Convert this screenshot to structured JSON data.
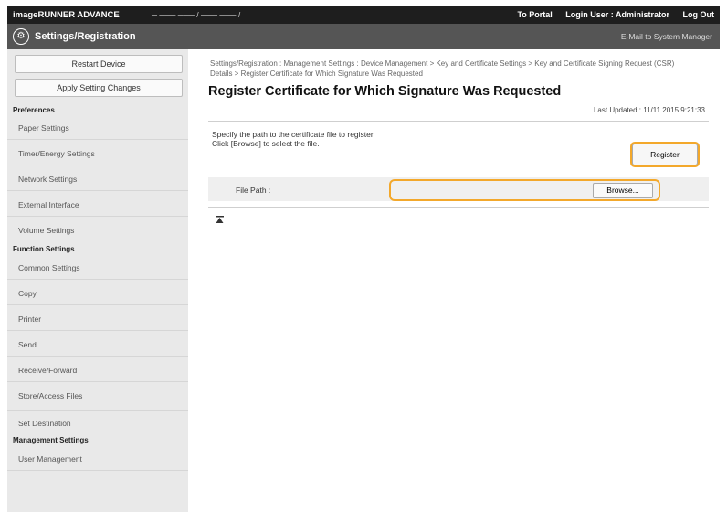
{
  "top": {
    "brand": "imageRUNNER ADVANCE",
    "device": "─ ─── ─── / ─── ─── /",
    "portal": "To Portal",
    "login": "Login User :  Administrator",
    "logout": "Log Out"
  },
  "title": {
    "app": "Settings/Registration",
    "mail": "E-Mail to System Manager"
  },
  "sidebar": {
    "restart": "Restart Device",
    "apply": "Apply Setting Changes",
    "preferences": "Preferences",
    "pref_items": [
      "Paper Settings",
      "Timer/Energy Settings",
      "Network Settings",
      "External Interface",
      "Volume Settings"
    ],
    "function": "Function Settings",
    "func_items": [
      "Common Settings",
      "Copy",
      "Printer",
      "Send",
      "Receive/Forward",
      "Store/Access Files"
    ],
    "setdest": "Set Destination",
    "management": "Management Settings",
    "mgmt_items": [
      "User Management"
    ]
  },
  "main": {
    "breadcrumb": "Settings/Registration : Management Settings : Device Management > Key and Certificate Settings > Key and Certificate Signing Request (CSR) Details > Register Certificate for Which Signature Was Requested",
    "title": "Register Certificate for Which Signature Was Requested",
    "updated": "Last Updated : 11/11 2015 9:21:33",
    "instruction1": "Specify the path to the certificate file to register.",
    "instruction2": "Click [Browse] to select the file.",
    "register": "Register",
    "file_path_label": "File Path :",
    "file_path_value": "",
    "browse": "Browse...",
    "top_icon": "top-arrow-icon"
  }
}
